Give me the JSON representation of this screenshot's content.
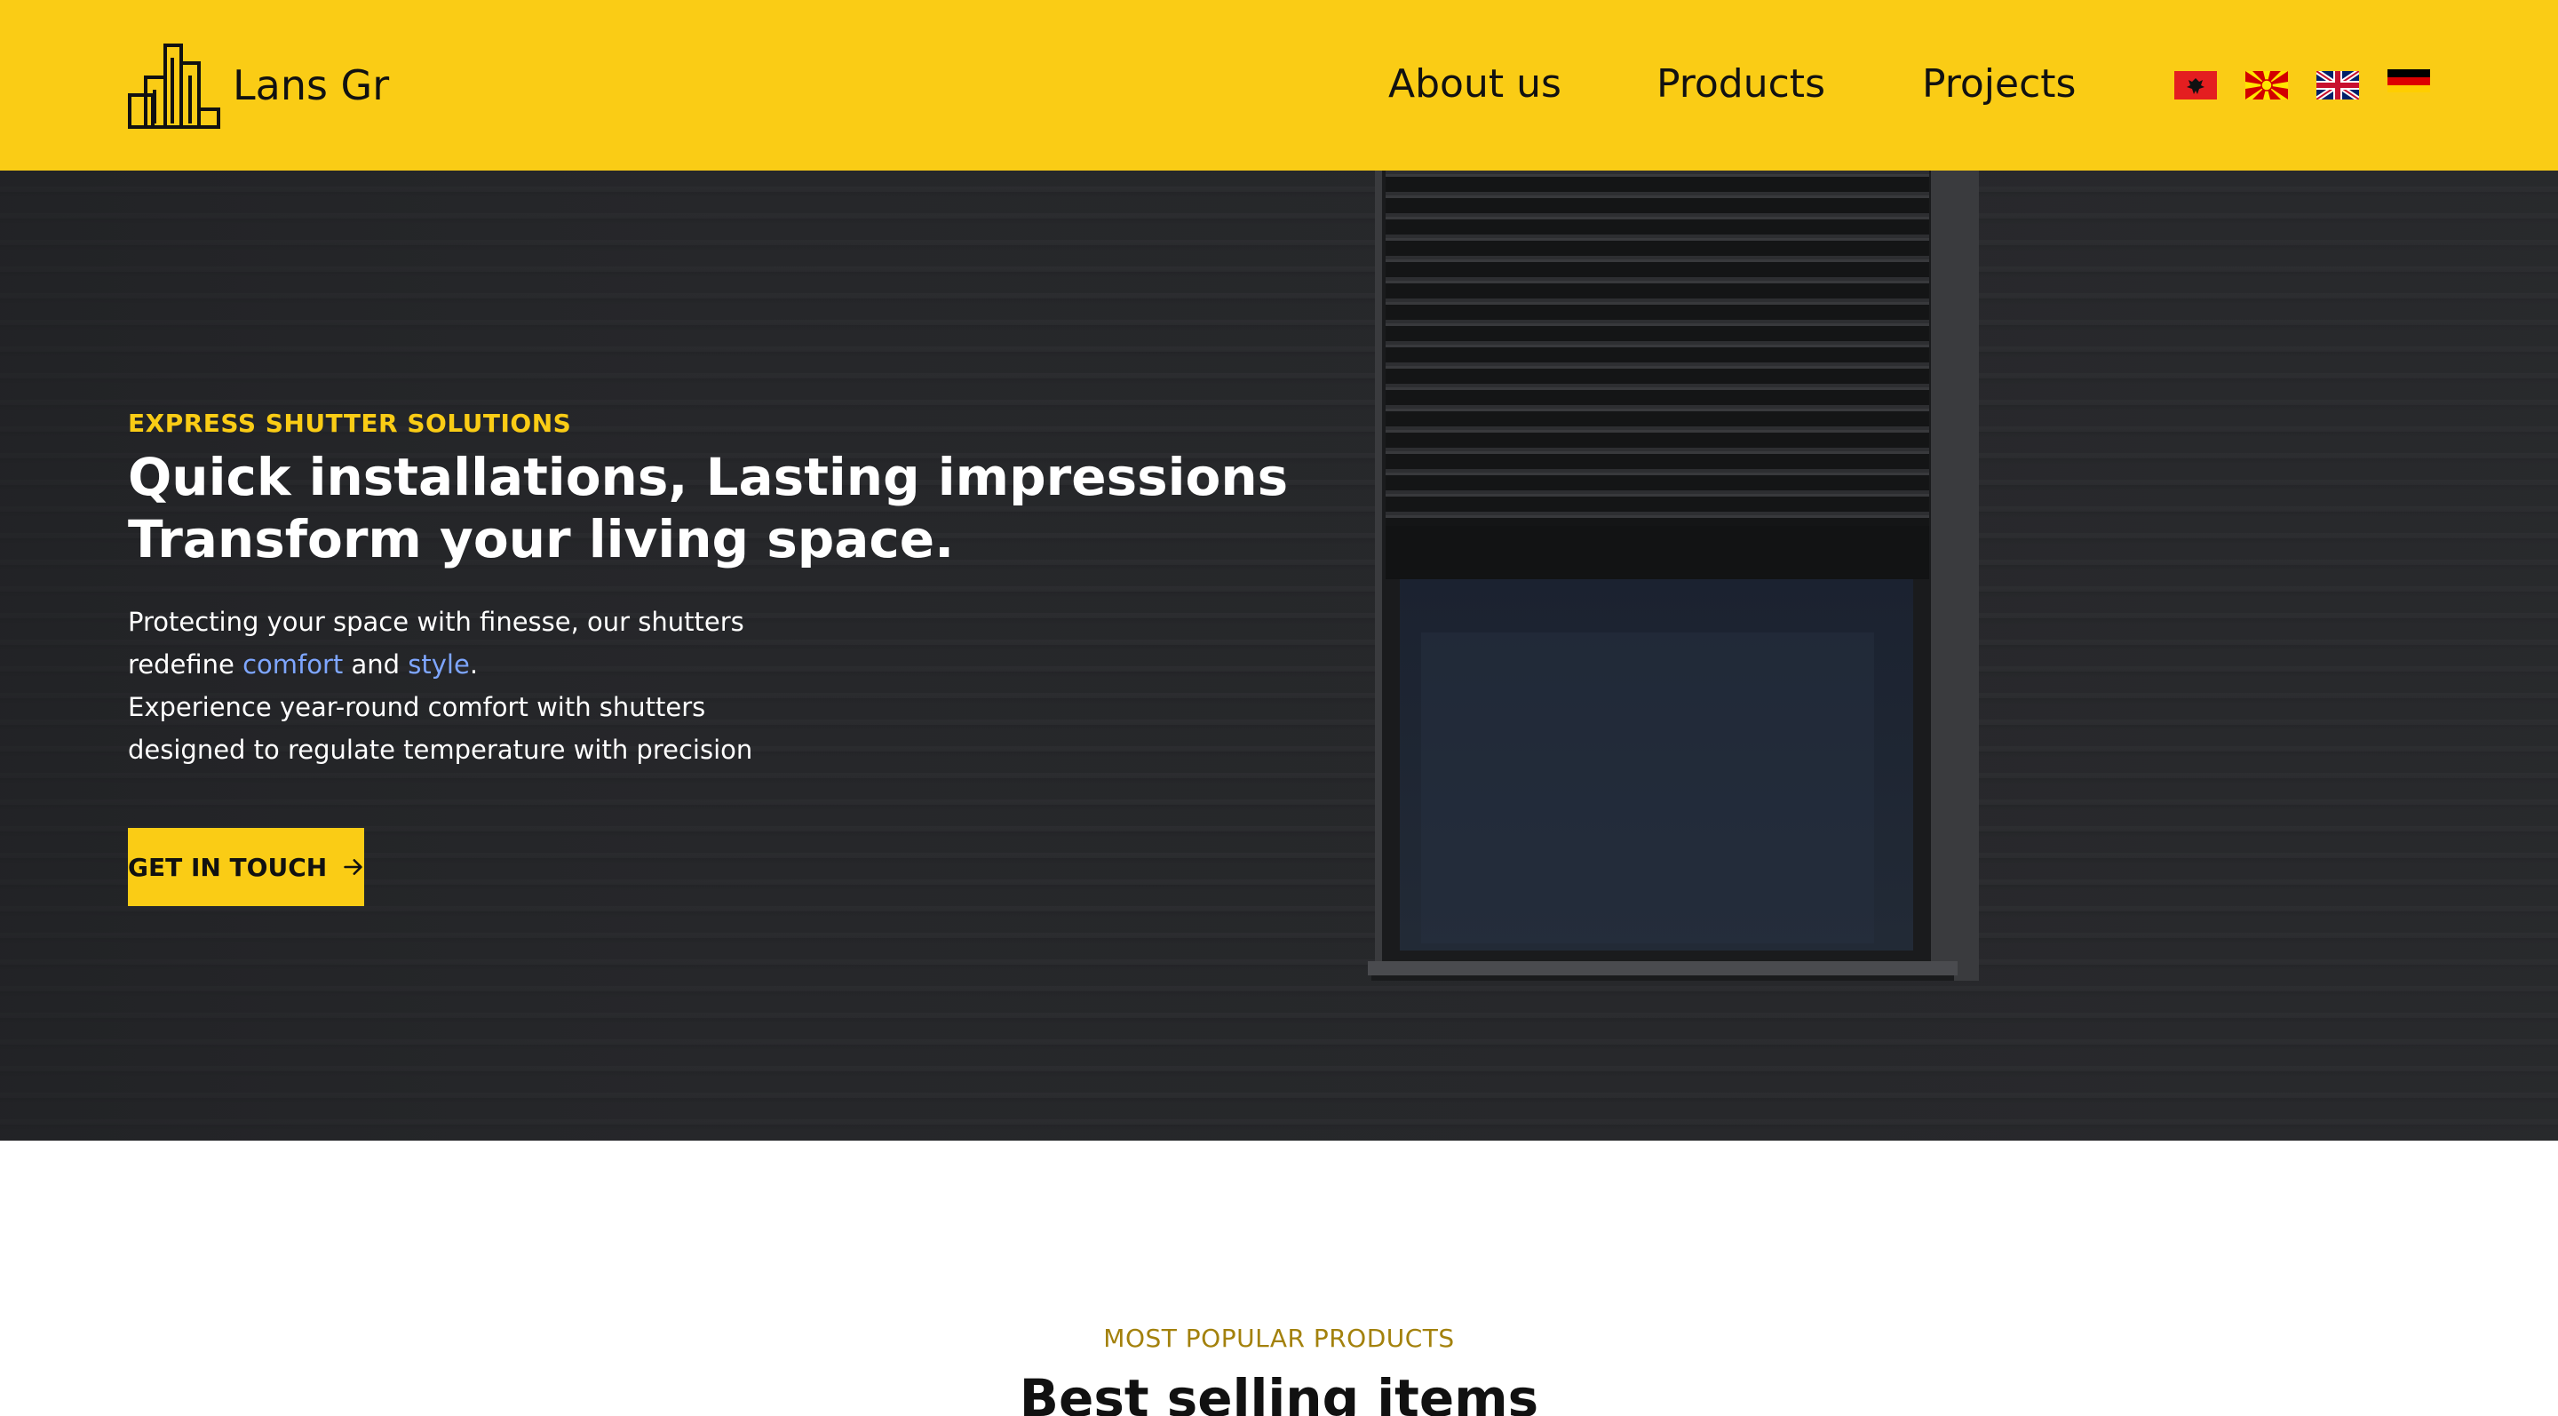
{
  "brand": {
    "name": "Lans Gr",
    "logo_icon": "buildings-icon"
  },
  "nav": {
    "items": [
      {
        "label": "About us"
      },
      {
        "label": "Products"
      },
      {
        "label": "Projects"
      }
    ],
    "languages": [
      {
        "icon": "flag-albania-icon"
      },
      {
        "icon": "flag-north-macedonia-icon"
      },
      {
        "icon": "flag-uk-icon"
      },
      {
        "icon": "flag-germany-icon"
      }
    ]
  },
  "hero": {
    "eyebrow": "EXPRESS SHUTTER SOLUTIONS",
    "headline_line1": "Quick installations, Lasting impressions",
    "headline_line2": "Transform your living space.",
    "body_line1": "Protecting your space with finesse, our shutters",
    "body_line2_prefix": "redefine ",
    "body_line2_word1": "comfort",
    "body_line2_mid": " and ",
    "body_line2_word2": "style",
    "body_line2_suffix": ".",
    "body_line3": "Experience year-round comfort with shutters",
    "body_line4": "designed to regulate temperature with precision",
    "cta_label": "GET IN TOUCH",
    "cta_icon": "arrow-right-icon"
  },
  "popular": {
    "eyebrow": "MOST POPULAR PRODUCTS",
    "title": "Best selling items"
  },
  "colors": {
    "accent": "#facc15",
    "hero_bg": "#26272a",
    "highlight": "#7ea6ff",
    "eyebrow_dark": "#a3810c"
  }
}
